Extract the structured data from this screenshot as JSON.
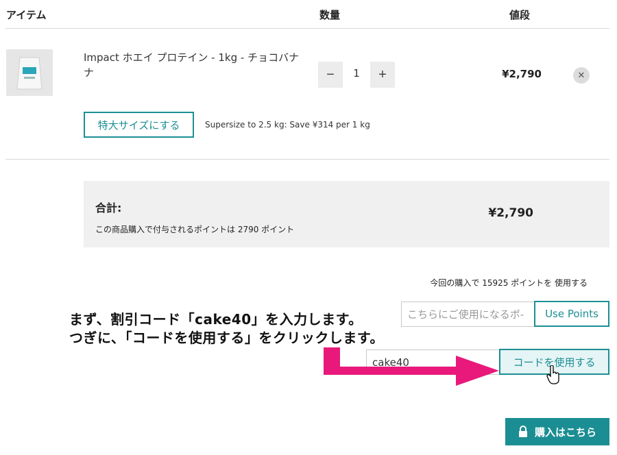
{
  "header": {
    "item": "アイテム",
    "quantity": "数量",
    "price": "値段"
  },
  "product": {
    "name": "Impact ホエイ プロテイン - 1kg - チョコバナナ",
    "quantity": "1",
    "price": "¥2,790",
    "supersize_label": "特大サイズにする",
    "supersize_note": "Supersize to 2.5 kg: Save ¥314 per 1 kg"
  },
  "totals": {
    "label": "合計:",
    "points_note": "この商品購入で付与されるポイントは 2790 ポイント",
    "value": "¥2,790"
  },
  "points": {
    "use_note": "今回の購入で 15925 ポイントを 使用する",
    "placeholder": "こちらにご使用になるポ-",
    "button": "Use Points"
  },
  "coupon": {
    "value": "cake40",
    "button": "コードを使用する"
  },
  "checkout": {
    "label": "購入はこちら"
  },
  "annotation": {
    "line1": "まず、割引コード「cake40」を入力します。",
    "line2": "つぎに、「コードを使用する」をクリックします。"
  },
  "colors": {
    "accent": "#1b8e93",
    "arrow": "#e8197a"
  }
}
